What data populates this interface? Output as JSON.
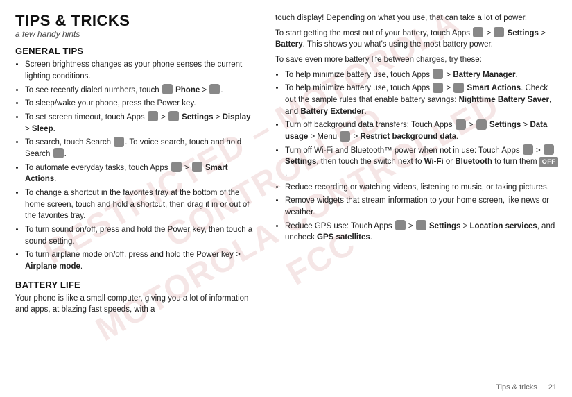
{
  "page": {
    "title": "TIPS & TRICKS",
    "subtitle": "a few handy hints"
  },
  "left": {
    "general_heading": "GENERAL TIPS",
    "tips": [
      "Screen brightness changes as your phone senses the current lighting conditions.",
      "To see recently dialed numbers, touch  Phone > .",
      "To sleep/wake your phone, press the Power key.",
      "To set screen timeout, touch Apps  >  Settings > Display > Sleep.",
      "To search, touch Search . To voice search, touch and hold Search .",
      "To automate everyday tasks, touch Apps  >  Smart Actions.",
      "To change a shortcut in the favorites tray at the bottom of the home screen, touch and hold a shortcut, then drag it in or out of the favorites tray.",
      "To turn sound on/off, press and hold the Power key, then touch a sound setting.",
      "To turn airplane mode on/off, press and hold the Power key > Airplane mode."
    ],
    "battery_heading": "BATTERY LIFE",
    "battery_intro": "Your phone is like a small computer, giving you a lot of information and apps, at blazing fast speeds, with a"
  },
  "right": {
    "battery_cont": "touch display! Depending on what you use, that can take a lot of power.",
    "battery_p1": "To start getting the most out of your battery, touch Apps  >  Settings > Battery. This shows you what's using the most battery power.",
    "battery_p2": "To save even more battery life between charges, try these:",
    "battery_tips": [
      "To help minimize battery use, touch Apps  > Battery Manager.",
      "To help minimize battery use, touch Apps  >  Smart Actions. Check out the sample rules that enable battery savings: Nighttime Battery Saver, and Battery Extender.",
      "Turn off background data transfers: Touch Apps  >  Settings > Data usage > Menu  > Restrict background data.",
      "Turn off Wi-Fi and Bluetooth™ power when not in use: Touch Apps  >  Settings, then touch the switch next to Wi-Fi or Bluetooth to turn them  OFF .",
      "Reduce recording or watching videos, listening to music, or taking pictures.",
      "Remove widgets that stream information to your home screen, like news or weather.",
      "Reduce GPS use: Touch Apps  >  Settings > Location services, and uncheck GPS satellites."
    ]
  },
  "footer": {
    "label": "Tips & tricks",
    "page_number": "21"
  }
}
